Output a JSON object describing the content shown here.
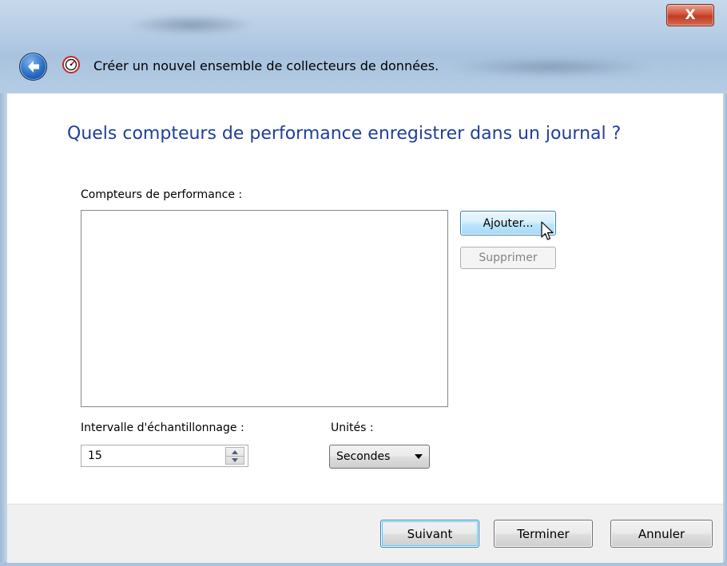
{
  "window": {
    "close_label": "X",
    "title": "Créer un nouvel ensemble de collecteurs de données."
  },
  "page": {
    "heading": "Quels compteurs de performance enregistrer dans un journal ?"
  },
  "counters": {
    "label": "Compteurs de performance :",
    "items": [],
    "add_label": "Ajouter...",
    "remove_label": "Supprimer"
  },
  "sampling": {
    "interval_label": "Intervalle d'échantillonnage :",
    "interval_value": "15",
    "units_label": "Unités :",
    "units_value": "Secondes"
  },
  "footer": {
    "next_label": "Suivant",
    "finish_label": "Terminer",
    "cancel_label": "Annuler"
  },
  "colors": {
    "heading": "#1f3f9a",
    "frame": "#b9cfe6",
    "close": "#c03c22"
  },
  "icons": [
    "close-icon",
    "back-arrow-icon",
    "wizard-icon",
    "spin-up-icon",
    "spin-down-icon",
    "dropdown-arrow-icon",
    "mouse-cursor-icon"
  ]
}
